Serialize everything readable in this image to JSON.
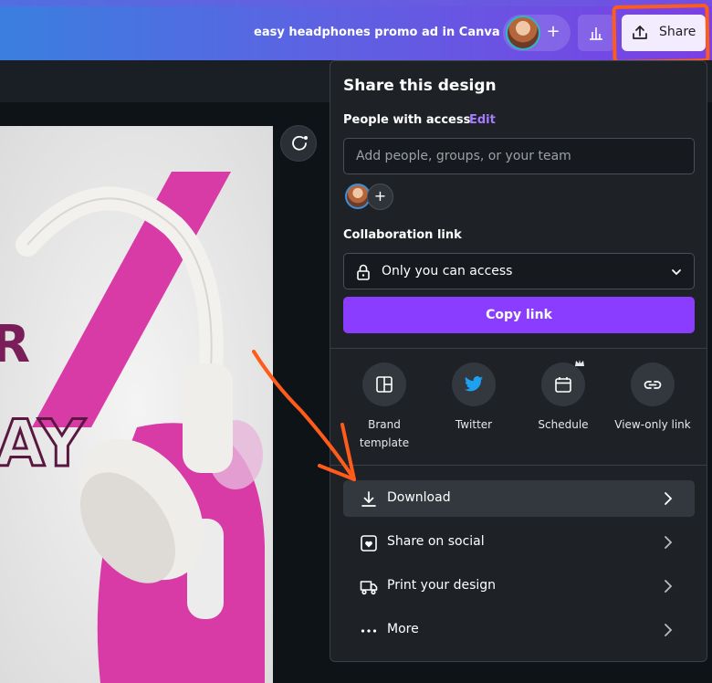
{
  "header": {
    "doc_title": "easy headphones promo ad in Canva",
    "share_label": "Share"
  },
  "share_panel": {
    "title": "Share this design",
    "people_label": "People with access",
    "edit_label": "Edit",
    "people_placeholder": "Add people, groups, or your team",
    "collab_label": "Collaboration link",
    "access_value": "Only you can access",
    "copy_label": "Copy link",
    "options": [
      {
        "label": "Brand template",
        "icon": "brand-template-icon"
      },
      {
        "label": "Twitter",
        "icon": "twitter-icon"
      },
      {
        "label": "Schedule",
        "icon": "calendar-icon"
      },
      {
        "label": "View-only link",
        "icon": "link-icon"
      }
    ],
    "rows": [
      {
        "label": "Download",
        "icon": "download-icon"
      },
      {
        "label": "Share on social",
        "icon": "heart-icon"
      },
      {
        "label": "Print your design",
        "icon": "truck-icon"
      },
      {
        "label": "More",
        "icon": "more-icon"
      }
    ]
  },
  "colors": {
    "accent": "#8b3dff",
    "highlight": "#ff5b1a",
    "design_pink": "#d83aa6"
  }
}
